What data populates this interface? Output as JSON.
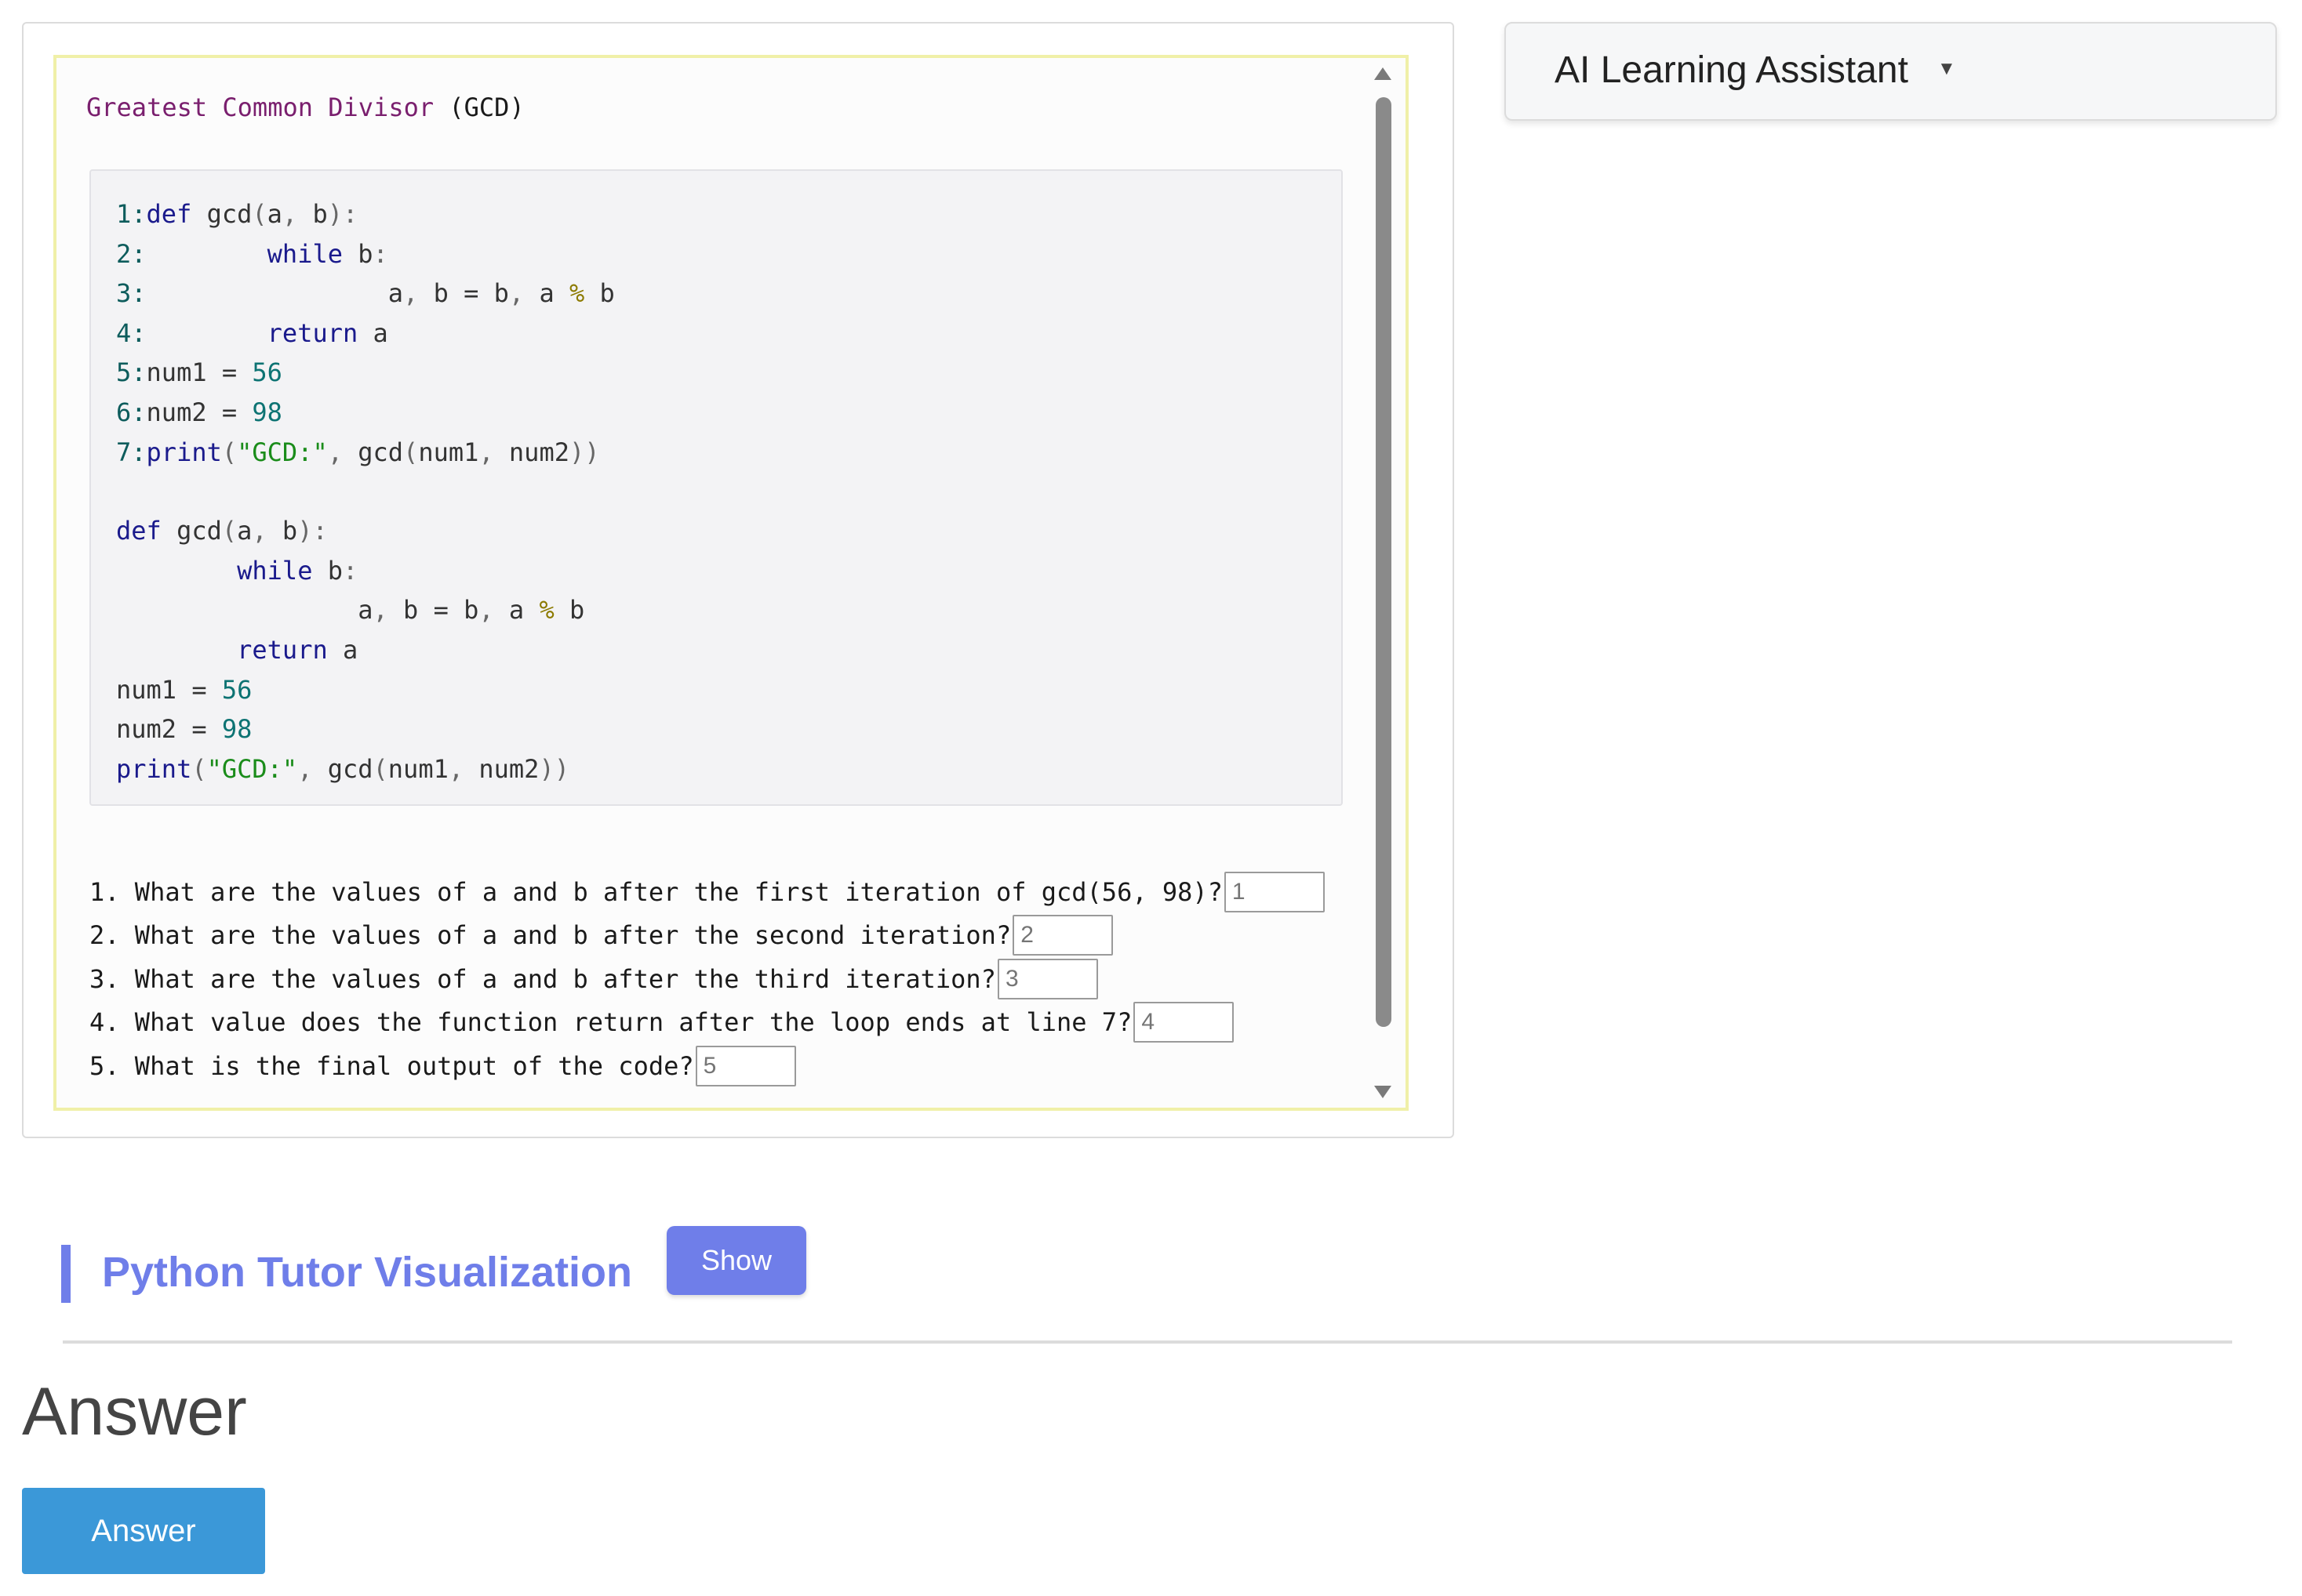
{
  "problem": {
    "title_words": [
      "Greatest",
      "Common",
      "Divisor"
    ],
    "title_paren": "(GCD)",
    "numbered_code": [
      {
        "ln": "1:",
        "text": "def gcd(a, b):"
      },
      {
        "ln": "2:",
        "text": "        while b:"
      },
      {
        "ln": "3:",
        "text": "                a, b = b, a % b"
      },
      {
        "ln": "4:",
        "text": "        return a"
      },
      {
        "ln": "5:",
        "text": "num1 = 56"
      },
      {
        "ln": "6:",
        "text": "num2 = 98"
      },
      {
        "ln": "7:",
        "text": "print(\"GCD:\", gcd(num1, num2))"
      }
    ],
    "plain_code": [
      "def gcd(a, b):",
      "        while b:",
      "                a, b = b, a % b",
      "        return a",
      "num1 = 56",
      "num2 = 98",
      "print(\"GCD:\", gcd(num1, num2))"
    ],
    "questions": [
      {
        "text": "1. What are the values of a and b after the first iteration of gcd(56, 98)?",
        "placeholder": "1"
      },
      {
        "text": "2. What are the values of a and b after the second iteration?",
        "placeholder": "2"
      },
      {
        "text": "3. What are the values of a and b after the third iteration?",
        "placeholder": "3"
      },
      {
        "text": "4. What value does the function return after the loop ends at line 7?",
        "placeholder": "4"
      },
      {
        "text": "5. What is the final output of the code?",
        "placeholder": "5"
      }
    ]
  },
  "ai_assistant": {
    "title": "AI Learning Assistant",
    "caret": "▼"
  },
  "python_tutor": {
    "title": "Python Tutor Visualization",
    "show_label": "Show"
  },
  "answer": {
    "heading": "Answer",
    "button_label": "Answer"
  },
  "colors": {
    "accent": "#6f7ee9",
    "answer_button": "#3b98d8",
    "frame_highlight": "#f0f0a8"
  },
  "icons": {
    "scroll_up": "scroll-up-arrow-icon",
    "scroll_down": "scroll-down-arrow-icon",
    "dropdown": "caret-down-icon"
  }
}
